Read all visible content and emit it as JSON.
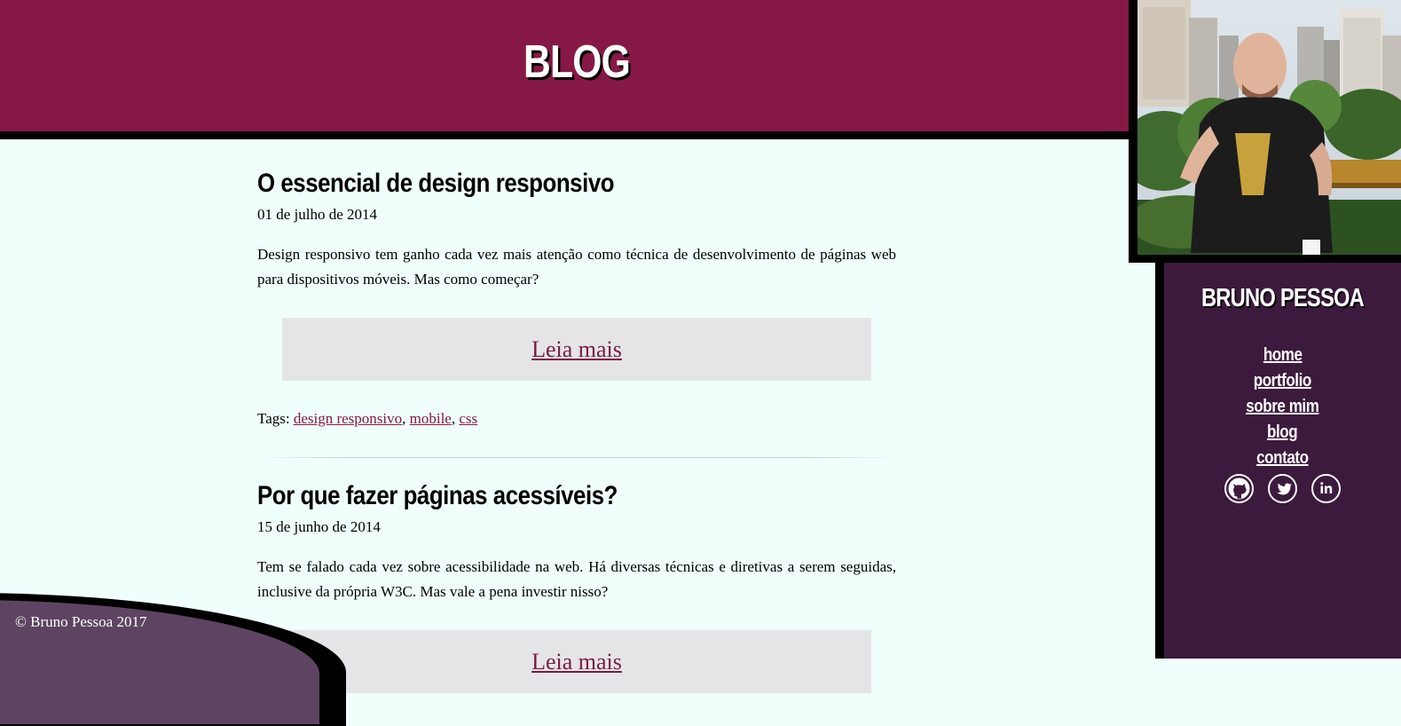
{
  "header": {
    "title": "BLOG"
  },
  "sidebar": {
    "name": "BRUNO PESSOA",
    "nav": [
      "home",
      "portfolio",
      "sobre mim",
      "blog",
      "contato"
    ],
    "social": [
      {
        "name": "github",
        "icon": "github-icon"
      },
      {
        "name": "twitter",
        "icon": "twitter-icon"
      },
      {
        "name": "linkedin",
        "icon": "linkedin-icon"
      }
    ]
  },
  "posts": [
    {
      "title": "O essencial de design responsivo",
      "date": "01 de julho de 2014",
      "excerpt": "Design responsivo tem ganho cada vez mais atenção como técnica de desenvolvimento de páginas web para dispositivos móveis. Mas como começar?",
      "read_more": "Leia mais",
      "tags_label": "Tags:",
      "tags": [
        "design responsivo",
        "mobile",
        "css"
      ]
    },
    {
      "title": "Por que fazer páginas acessíveis?",
      "date": "15 de junho de 2014",
      "excerpt": "Tem se falado cada vez sobre acessibilidade na web. Há diversas técnicas e diretivas a serem seguidas, inclusive da própria W3C. Mas vale a pena investir nisso?",
      "read_more": "Leia mais"
    }
  ],
  "footer": {
    "copyright": "© Bruno Pessoa 2017"
  },
  "colors": {
    "header_bg": "#861846",
    "sidebar_bg": "#3c1a3d",
    "page_bg": "#f0fffb",
    "link": "#861846",
    "footer_bg": "#5e4462"
  }
}
